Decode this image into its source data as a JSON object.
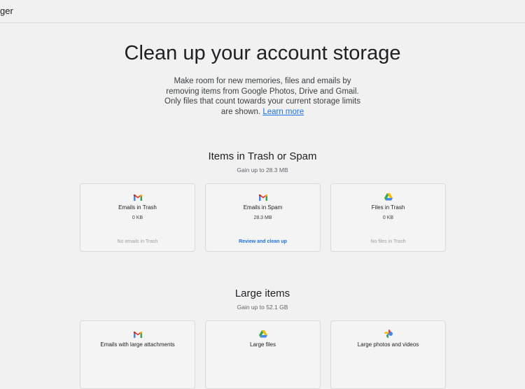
{
  "header": {
    "app_name": "ger"
  },
  "main": {
    "title": "Clean up your account storage",
    "intro_text": "Make room for new memories, files and emails by removing items from Google Photos, Drive and Gmail. Only files that count towards your current storage limits are shown.",
    "learn_more": "Learn more"
  },
  "sections": [
    {
      "title": "Items in Trash or Spam",
      "subtitle": "Gain up to 28.3 MB",
      "cards": [
        {
          "icon": "gmail-icon",
          "label": "Emails in Trash",
          "size": "0 KB",
          "action": "No emails in Trash"
        },
        {
          "icon": "gmail-icon",
          "label": "Emails in Spam",
          "size": "28.3 MB",
          "action": "Review and clean up"
        },
        {
          "icon": "drive-icon",
          "label": "Files in Trash",
          "size": "0 KB",
          "action": "No files in Trash"
        }
      ]
    },
    {
      "title": "Large items",
      "subtitle": "Gain up to 52.1 GB",
      "cards": [
        {
          "icon": "gmail-icon",
          "label": "Emails with large attachments"
        },
        {
          "icon": "drive-icon",
          "label": "Large files"
        },
        {
          "icon": "photos-icon",
          "label": "Large photos and videos"
        }
      ]
    }
  ],
  "colors": {
    "background": "#f1f1f1",
    "link": "#1a73e8",
    "muted": "#a0a0a0",
    "card_border": "#d9d9d9"
  }
}
